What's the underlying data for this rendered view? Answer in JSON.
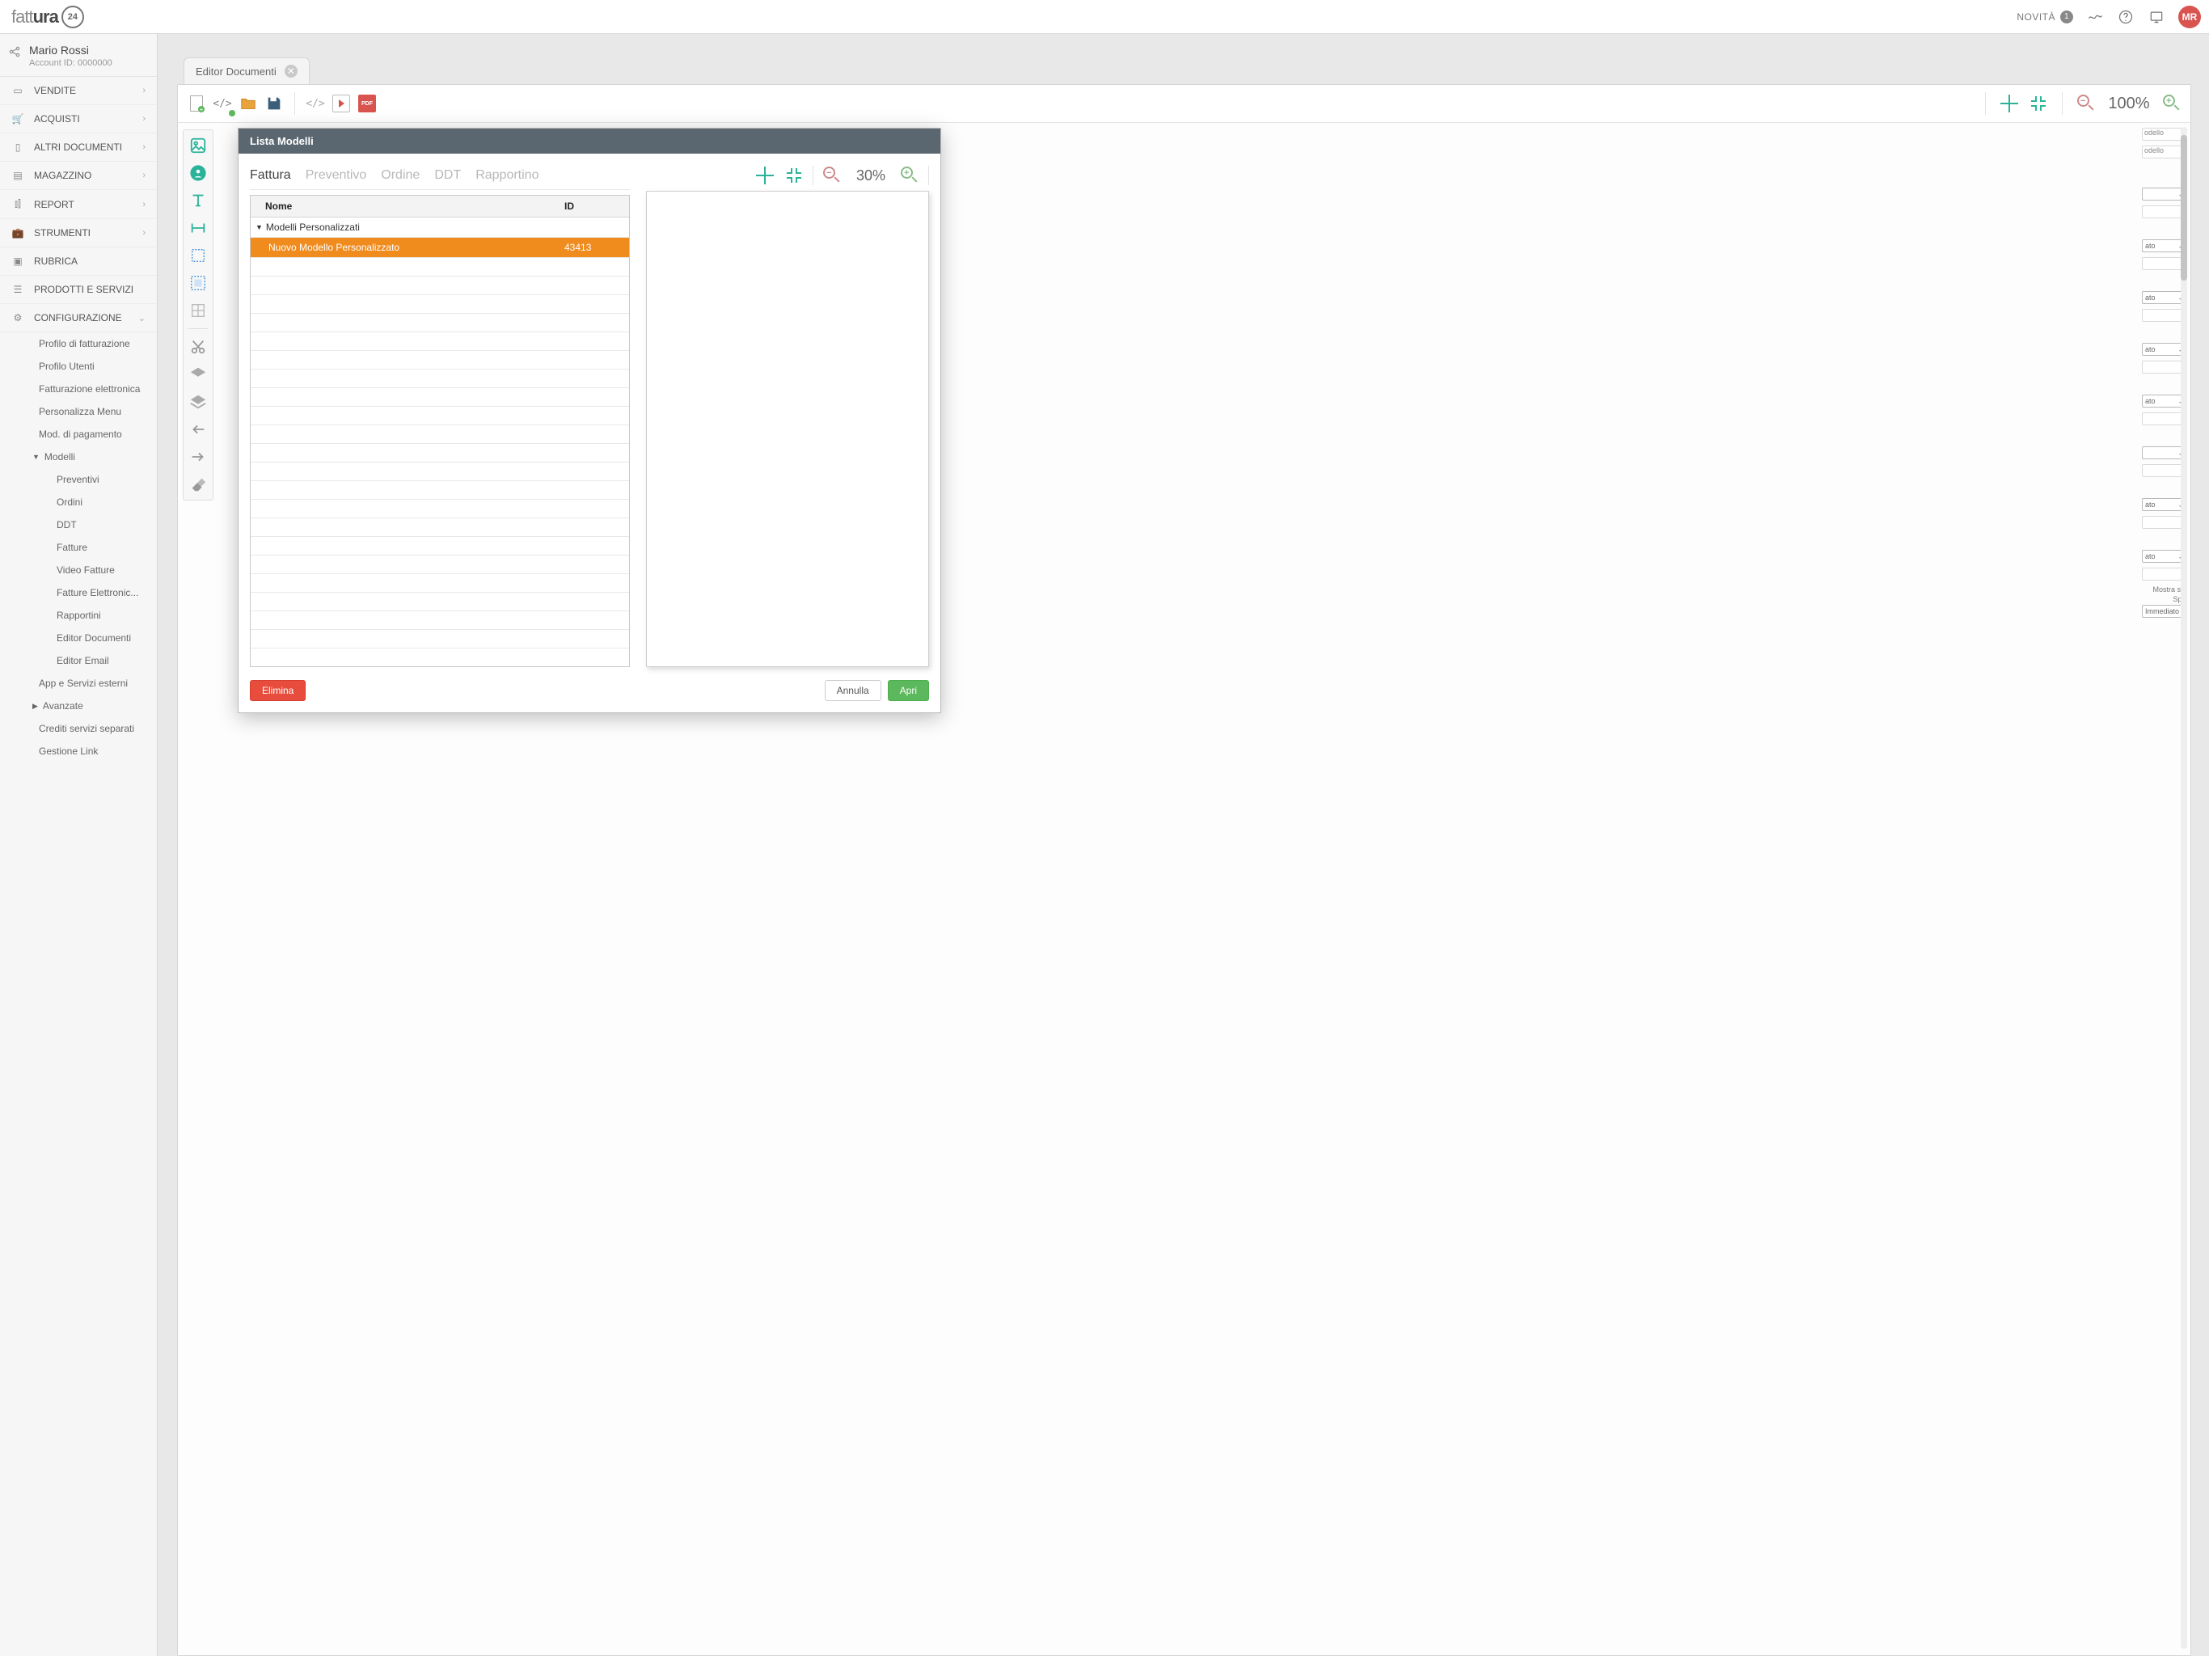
{
  "header": {
    "logo_light": "fatt",
    "logo_dark": "ura",
    "logo_badge": "24",
    "novita_label": "NOVITÀ",
    "novita_count": "1",
    "avatar_initials": "MR"
  },
  "user": {
    "name": "Mario Rossi",
    "account_id": "Account ID: 0000000"
  },
  "nav": {
    "vendite": "VENDITE",
    "acquisti": "ACQUISTI",
    "altri_documenti": "ALTRI DOCUMENTI",
    "magazzino": "MAGAZZINO",
    "report": "REPORT",
    "strumenti": "STRUMENTI",
    "rubrica": "RUBRICA",
    "prodotti": "PRODOTTI E SERVIZI",
    "configurazione": "CONFIGURAZIONE"
  },
  "config_sub": {
    "profilo_fatt": "Profilo di fatturazione",
    "profilo_utenti": "Profilo Utenti",
    "fatt_elettronica": "Fatturazione elettronica",
    "personalizza_menu": "Personalizza Menu",
    "mod_pagamento": "Mod. di pagamento",
    "modelli": "Modelli",
    "modelli_children": {
      "preventivi": "Preventivi",
      "ordini": "Ordini",
      "ddt": "DDT",
      "fatture": "Fatture",
      "video_fatture": "Video Fatture",
      "fatture_elettr": "Fatture Elettronic...",
      "rapportini": "Rapportini",
      "editor_documenti": "Editor Documenti",
      "editor_email": "Editor Email"
    },
    "app_servizi": "App e Servizi esterni",
    "avanzate": "Avanzate",
    "crediti": "Crediti servizi separati",
    "gestione_link": "Gestione Link"
  },
  "editor": {
    "tab_label": "Editor Documenti",
    "zoom": "100%"
  },
  "modal": {
    "title": "Lista Modelli",
    "tabs": {
      "fattura": "Fattura",
      "preventivo": "Preventivo",
      "ordine": "Ordine",
      "ddt": "DDT",
      "rapportino": "Rapportino"
    },
    "columns": {
      "nome": "Nome",
      "id": "ID"
    },
    "group_label": "Modelli Personalizzati",
    "selected_row": {
      "name": "Nuovo Modello Personalizzato",
      "id": "43413"
    },
    "preview_zoom": "30%",
    "buttons": {
      "elimina": "Elimina",
      "annulla": "Annulla",
      "apri": "Apri"
    }
  },
  "rightpanel": {
    "hint1": "odello",
    "hint2": "odello",
    "sel_text": "ato",
    "mostra_se": "Mostra se",
    "split": "Split",
    "split_value": "Immediato"
  }
}
